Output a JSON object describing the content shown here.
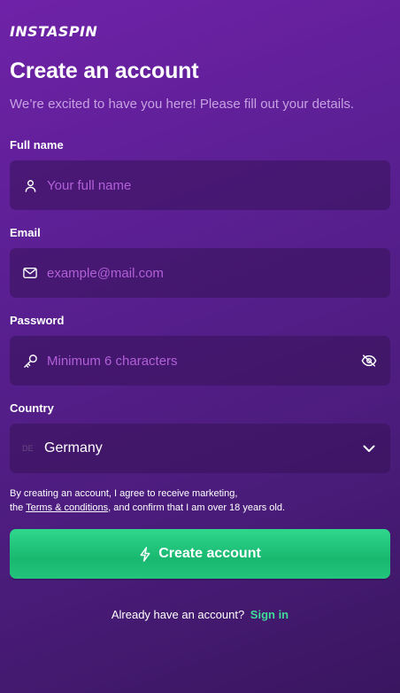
{
  "brand": {
    "logo_text": "INSTASPIN"
  },
  "header": {
    "title": "Create an account",
    "subtitle": "We’re excited to have you here! Please fill out your details."
  },
  "form": {
    "full_name": {
      "label": "Full name",
      "placeholder": "Your full name",
      "value": "",
      "icon": "user-icon"
    },
    "email": {
      "label": "Email",
      "placeholder": "example@mail.com",
      "value": "",
      "icon": "mail-icon"
    },
    "password": {
      "label": "Password",
      "placeholder": "Minimum 6 characters",
      "value": "",
      "icon": "key-icon",
      "toggle_icon": "eye-off-icon"
    },
    "country": {
      "label": "Country",
      "code": "DE",
      "selected": "Germany",
      "icon": "chevron-down-icon"
    }
  },
  "consent": {
    "line1": "By creating an account, I agree to receive marketing,",
    "pre_link": "the ",
    "link": "Terms & conditions",
    "post_link": ", and confirm that I am over 18 years old."
  },
  "cta": {
    "label": "Create account",
    "icon": "lightning-icon"
  },
  "footer": {
    "prompt": "Already have an account?",
    "link": "Sign in"
  },
  "colors": {
    "accent": "#22c47c",
    "link": "#3fdc9a",
    "placeholder": "#b160d8",
    "background": "#5a1f92"
  }
}
